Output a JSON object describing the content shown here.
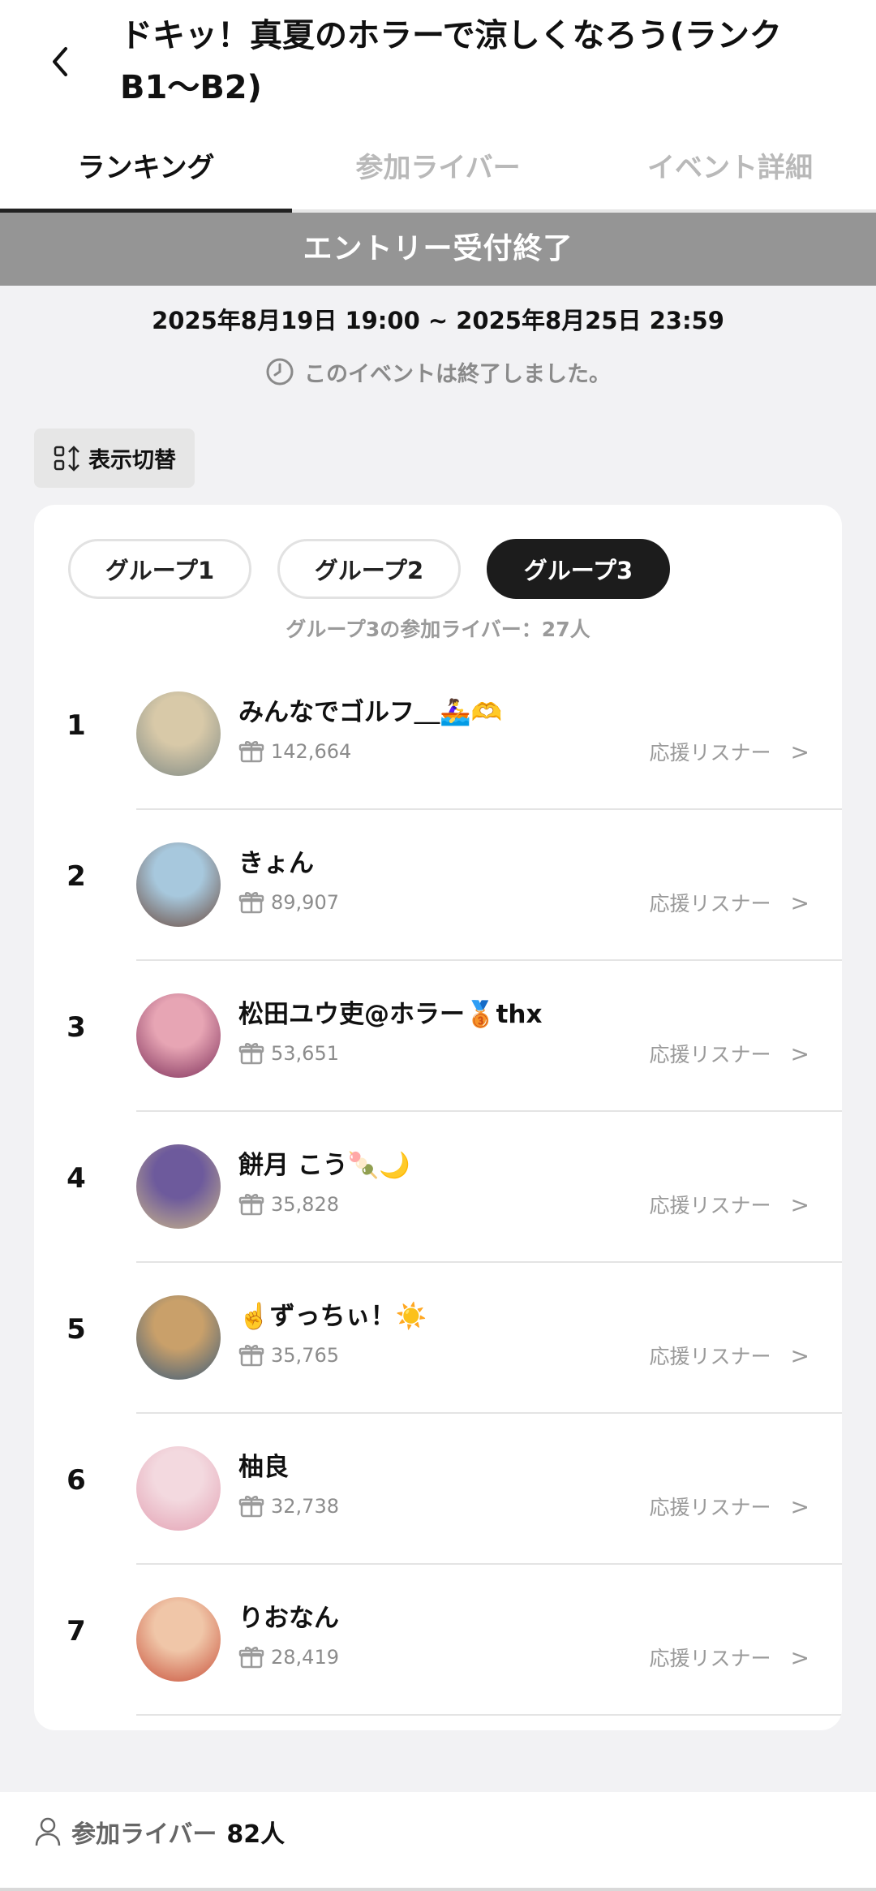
{
  "header": {
    "title": "ドキッ！真夏のホラーで涼しくなろう(ランクB1〜B2)",
    "back_icon": "chevron-left-icon"
  },
  "tabs": [
    {
      "label": "ランキング",
      "active": true
    },
    {
      "label": "参加ライバー",
      "active": false
    },
    {
      "label": "イベント詳細",
      "active": false
    }
  ],
  "banner": "エントリー受付終了",
  "period": "2025年8月19日 19:00 ~ 2025年8月25日 23:59",
  "ended_text": "このイベントは終了しました。",
  "toggle_label": "表示切替",
  "groups": [
    {
      "label": "グループ1",
      "active": false
    },
    {
      "label": "グループ2",
      "active": false
    },
    {
      "label": "グループ3",
      "active": true
    }
  ],
  "group_count": "グループ3の参加ライバー：27人",
  "support_label": "応援リスナー",
  "ranking": [
    {
      "rank": "1",
      "name": "みんなでゴルフ＿🚣‍♀️🫶",
      "score": "142,664",
      "avatar_colors": [
        "#d8c9a8",
        "#7f8a86"
      ]
    },
    {
      "rank": "2",
      "name": "きょん",
      "score": "89,907",
      "avatar_colors": [
        "#a7c8dd",
        "#6b4a3e"
      ]
    },
    {
      "rank": "3",
      "name": "松田ユウ吏@ホラー🥉thx",
      "score": "53,651",
      "avatar_colors": [
        "#e7a5b4",
        "#7e2f5a"
      ]
    },
    {
      "rank": "4",
      "name": "餅月 こう🍡🌙",
      "score": "35,828",
      "avatar_colors": [
        "#6d5a9c",
        "#c9b58a"
      ]
    },
    {
      "rank": "5",
      "name": "☝️ずっちぃ！☀️",
      "score": "35,765",
      "avatar_colors": [
        "#c9a06a",
        "#3c5c7a"
      ]
    },
    {
      "rank": "6",
      "name": "柚良",
      "score": "32,738",
      "avatar_colors": [
        "#f3d9df",
        "#e3a1b3"
      ]
    },
    {
      "rank": "7",
      "name": "りおなん",
      "score": "28,419",
      "avatar_colors": [
        "#f0c6a8",
        "#c8503a"
      ]
    }
  ],
  "footer": {
    "label": "参加ライバー",
    "count": "82人"
  }
}
